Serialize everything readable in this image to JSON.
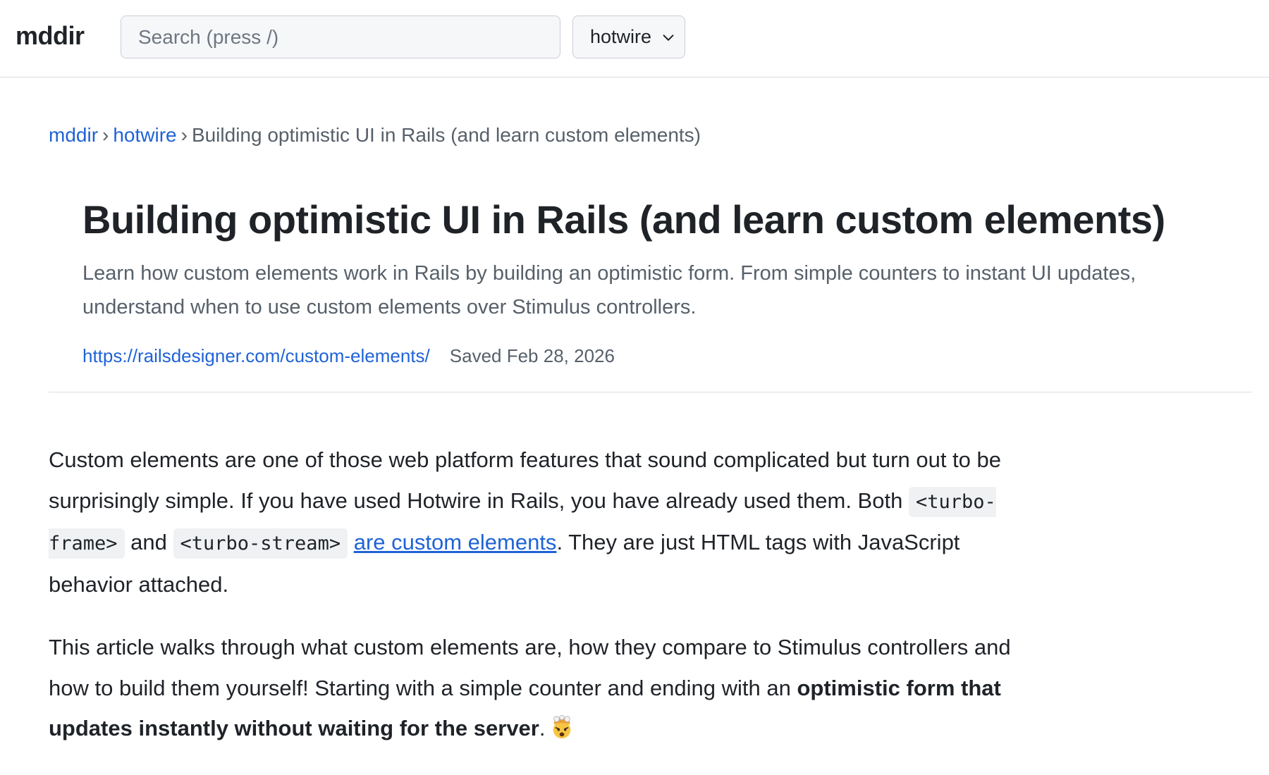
{
  "topbar": {
    "brand": "mddir",
    "search_placeholder": "Search (press /)",
    "search_value": "",
    "filter_selected": "hotwire",
    "filter_icon": "chevron-down-icon"
  },
  "breadcrumb": {
    "home": "mddir",
    "sep1": "›",
    "category": "hotwire",
    "sep2": "›",
    "current": "Building optimistic UI in Rails (and learn custom elements)"
  },
  "article_header": {
    "title": "Building optimistic UI in Rails (and learn custom elements)",
    "description": "Learn how custom elements work in Rails by building an optimistic form. From simple counters to instant UI updates, understand when to use custom elements over Stimulus controllers.",
    "source_url": "https://railsdesigner.com/custom-elements/",
    "saved_label": "Saved Feb 28, 2026"
  },
  "body": {
    "p1_text1": "Custom elements are one of those web platform features that sound complicated but turn out to be surprisingly simple. If you have used Hotwire in Rails, you have already used them. Both ",
    "p1_code1": "<turbo-frame>",
    "p1_text2": " and ",
    "p1_code2": "<turbo-stream>",
    "p1_text3": " ",
    "p1_link": "are custom elements",
    "p1_text4": ". They are just HTML tags with JavaScript behavior attached.",
    "p2_text1": "This article walks through what custom elements are, how they compare to Stimulus controllers and how to build them yourself! Starting with a simple counter and ending with an ",
    "p2_bold": "optimistic form that updates instantly without waiting for the server",
    "p2_text2": ".",
    "p2_emoji_icon": "exploding-head-emoji"
  },
  "colors": {
    "link": "#1f63d6",
    "text": "#1f2328",
    "muted": "#57606a",
    "border": "#d8dbe0",
    "code_bg": "#eff1f3"
  }
}
